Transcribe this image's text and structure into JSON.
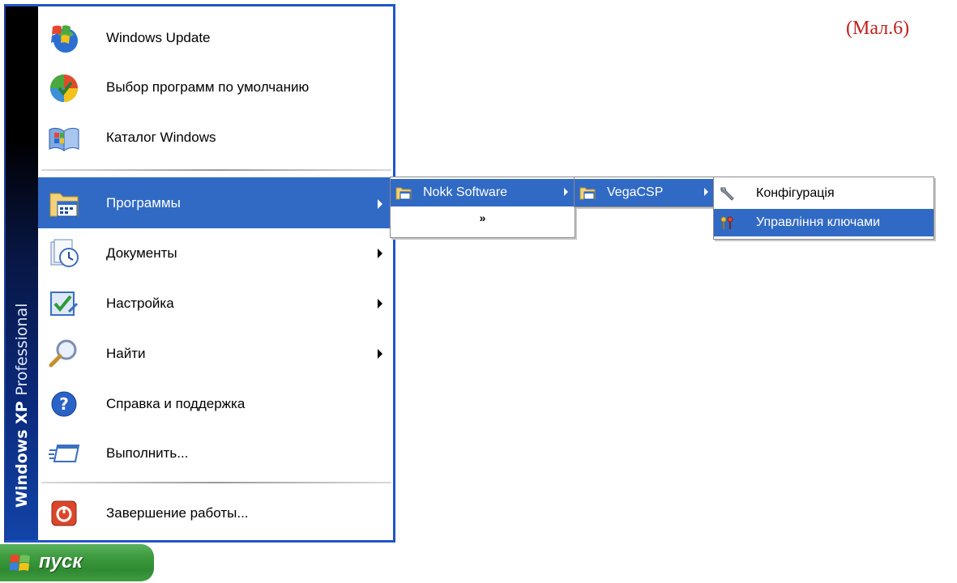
{
  "caption": "(Мал.6)",
  "sidebar_brand": {
    "bold": "Windows XP",
    "light": "Professional"
  },
  "start_menu": {
    "pinned": [
      {
        "label": "Windows Update",
        "icon": "windows-update-icon"
      },
      {
        "label": "Выбор программ по умолчанию",
        "icon": "default-programs-icon"
      },
      {
        "label": "Каталог Windows",
        "icon": "windows-catalog-icon"
      }
    ],
    "programs": {
      "label": "Программы",
      "icon": "programs-folder-icon",
      "has_submenu": true,
      "selected": true
    },
    "documents": {
      "label": "Документы",
      "icon": "documents-icon",
      "has_submenu": true
    },
    "settings": {
      "label": "Настройка",
      "icon": "settings-icon",
      "has_submenu": true
    },
    "search": {
      "label": "Найти",
      "icon": "search-icon",
      "has_submenu": true
    },
    "help": {
      "label": "Справка и поддержка",
      "icon": "help-icon"
    },
    "run": {
      "label": "Выполнить...",
      "icon": "run-icon"
    },
    "shutdown": {
      "label": "Завершение работы...",
      "icon": "shutdown-icon"
    }
  },
  "submenu_programs": {
    "items": [
      {
        "label": "Nokk Software",
        "icon": "program-group-icon",
        "selected": true,
        "has_submenu": true
      }
    ],
    "expand_glyph": "»"
  },
  "submenu_nokk": {
    "items": [
      {
        "label": "VegaCSP",
        "icon": "program-group-icon",
        "selected": true,
        "has_submenu": true
      }
    ]
  },
  "submenu_vegacsp": {
    "items": [
      {
        "label": "Конфігурація",
        "icon": "wrench-icon",
        "selected": false
      },
      {
        "label": "Управління ключами",
        "icon": "key-management-icon",
        "selected": true
      }
    ]
  },
  "start_button": {
    "label": "пуск",
    "icon": "windows-flag-icon"
  },
  "colors": {
    "selection": "#316ac5",
    "caption": "#c0201e",
    "start_green": "#3d9b3e",
    "menu_border": "#2155c4"
  }
}
